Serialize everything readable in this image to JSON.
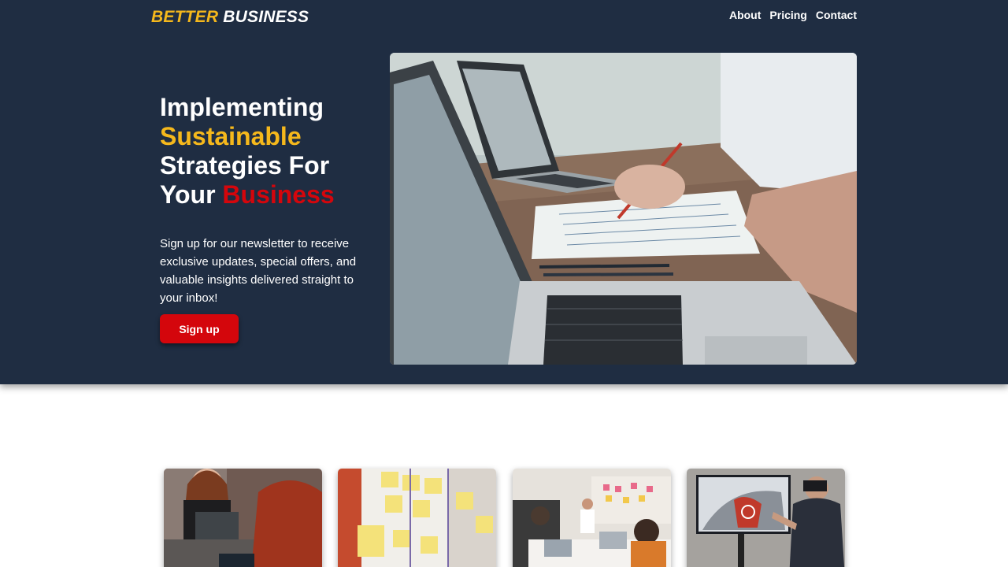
{
  "brand": {
    "part1": "BETTER",
    "part2": "BUSINESS"
  },
  "nav": {
    "items": [
      {
        "label": "About"
      },
      {
        "label": "Pricing"
      },
      {
        "label": "Contact"
      }
    ]
  },
  "hero": {
    "headline": {
      "line1": "Implementing",
      "line2": "Sustainable",
      "line3": "Strategies For",
      "line4a": "Your",
      "line4b": "Business"
    },
    "description": "Sign up for our newsletter to receive exclusive updates, special offers, and valuable insights delivered straight to your inbox!",
    "signup_label": "Sign up"
  },
  "colors": {
    "navy": "#1f2d42",
    "accent_yellow": "#f5b81c",
    "accent_red": "#d4060c"
  },
  "cards": [
    {
      "name": "card-retail-checkout"
    },
    {
      "name": "card-sticky-notes-board"
    },
    {
      "name": "card-team-meeting"
    },
    {
      "name": "card-vr-demo"
    }
  ]
}
